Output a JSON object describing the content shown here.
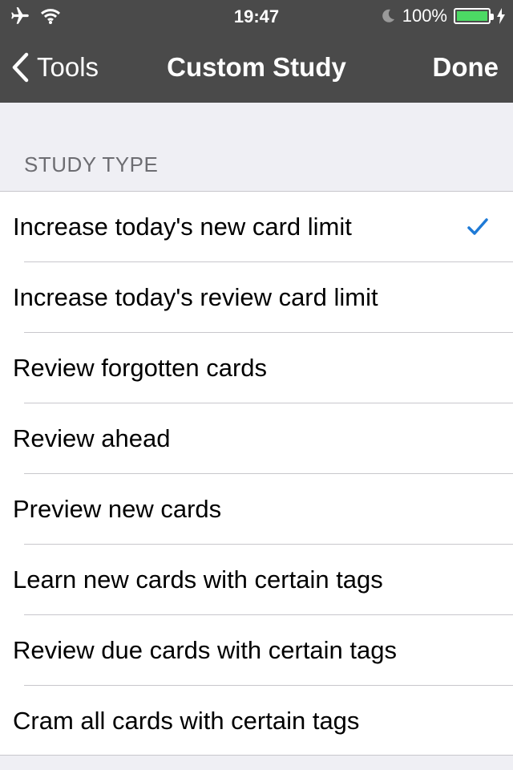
{
  "status_bar": {
    "time": "19:47",
    "battery_percent": "100%",
    "battery_level": 1.0,
    "icons": [
      "airplane-icon",
      "wifi-icon",
      "moon-icon",
      "battery-icon",
      "charging-icon"
    ]
  },
  "nav": {
    "back_label": "Tools",
    "title": "Custom Study",
    "done_label": "Done"
  },
  "section": {
    "header": "STUDY TYPE"
  },
  "options": [
    {
      "label": "Increase today's new card limit",
      "selected": true
    },
    {
      "label": "Increase today's review card limit",
      "selected": false
    },
    {
      "label": "Review forgotten cards",
      "selected": false
    },
    {
      "label": "Review ahead",
      "selected": false
    },
    {
      "label": "Preview new cards",
      "selected": false
    },
    {
      "label": "Learn new cards with certain tags",
      "selected": false
    },
    {
      "label": "Review due cards with certain tags",
      "selected": false
    },
    {
      "label": "Cram all cards with certain tags",
      "selected": false
    }
  ],
  "colors": {
    "bar_background": "#4a4a4a",
    "accent": "#1e7ad6",
    "battery_green": "#4cd964"
  }
}
